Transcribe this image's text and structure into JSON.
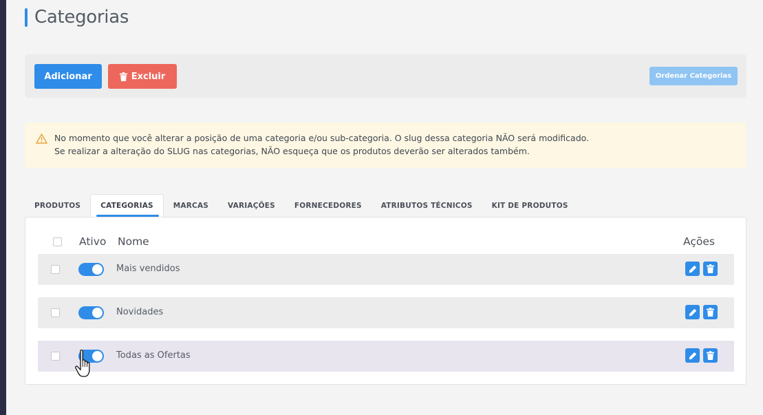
{
  "page": {
    "title": "Categorias"
  },
  "toolbar": {
    "add_label": "Adicionar",
    "delete_label": "Excluir",
    "order_label": "Ordenar Categorias"
  },
  "alert": {
    "line1": "No momento que você alterar a posição de uma categoria e/ou sub-categoria. O slug dessa categoria NÃO será modificado.",
    "line2": "Se realizar a alteração do SLUG nas categorias, NÃO esqueça que os produtos deverão ser alterados também."
  },
  "tabs": [
    {
      "label": "PRODUTOS",
      "active": false
    },
    {
      "label": "CATEGORIAS",
      "active": true
    },
    {
      "label": "MARCAS",
      "active": false
    },
    {
      "label": "VARIAÇÕES",
      "active": false
    },
    {
      "label": "FORNECEDORES",
      "active": false
    },
    {
      "label": "ATRIBUTOS TÉCNICOS",
      "active": false
    },
    {
      "label": "KIT DE PRODUTOS",
      "active": false
    }
  ],
  "table": {
    "headers": {
      "ativo": "Ativo",
      "nome": "Nome",
      "acoes": "Ações"
    },
    "rows": [
      {
        "name": "Mais vendidos",
        "active": true
      },
      {
        "name": "Novidades",
        "active": true
      },
      {
        "name": "Todas as Ofertas",
        "active": true
      }
    ]
  },
  "colors": {
    "primary": "#2f8ce8",
    "danger": "#ee675c",
    "alert_bg": "#fdf7e3",
    "sidebar": "#2a2d45"
  },
  "icons": [
    "trash-icon",
    "warning-icon",
    "pencil-icon",
    "hand-pointer-cursor"
  ]
}
